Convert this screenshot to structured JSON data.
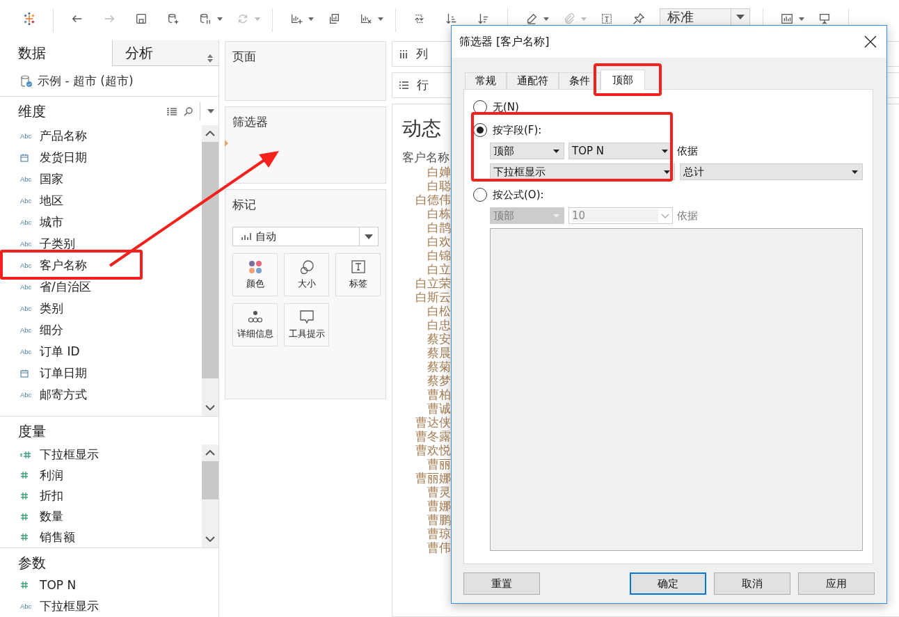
{
  "toolbar": {
    "buttons": [
      {
        "kind": "logo"
      },
      {
        "kind": "sep"
      },
      {
        "kind": "back",
        "disabled": false,
        "menu": false
      },
      {
        "kind": "forward",
        "disabled": true,
        "menu": false
      },
      {
        "kind": "save",
        "disabled": false,
        "menu": false
      },
      {
        "kind": "datasource-add",
        "disabled": false,
        "menu": false
      },
      {
        "kind": "datasource-pause",
        "disabled": false,
        "menu": true
      },
      {
        "kind": "refresh",
        "disabled": true,
        "menu": true
      },
      {
        "kind": "sep"
      },
      {
        "kind": "sheet-add",
        "disabled": false,
        "menu": true
      },
      {
        "kind": "duplicate",
        "disabled": false,
        "menu": false
      },
      {
        "kind": "clear",
        "disabled": false,
        "menu": true
      },
      {
        "kind": "sep"
      },
      {
        "kind": "swap",
        "disabled": false,
        "menu": false
      },
      {
        "kind": "sort-asc",
        "disabled": false,
        "menu": false
      },
      {
        "kind": "sort-desc",
        "disabled": false,
        "menu": false
      },
      {
        "kind": "sep"
      },
      {
        "kind": "pen",
        "disabled": false,
        "menu": true
      },
      {
        "kind": "paperclip",
        "disabled": true,
        "menu": true
      },
      {
        "kind": "label",
        "disabled": false,
        "menu": false
      },
      {
        "kind": "pin",
        "disabled": false,
        "menu": false
      },
      {
        "kind": "view-select",
        "value": "标准"
      },
      {
        "kind": "sep"
      },
      {
        "kind": "show-me",
        "disabled": false,
        "menu": true
      },
      {
        "kind": "presentation",
        "disabled": false,
        "menu": false
      },
      {
        "kind": "sep"
      }
    ]
  },
  "data_pane": {
    "tabs": [
      {
        "label": "数据",
        "selected": true
      },
      {
        "label": "分析",
        "selected": false
      }
    ],
    "datasource": "示例 - 超市 (超市)",
    "sections": [
      {
        "title": "维度",
        "tools": true,
        "fields": [
          {
            "name": "产品名称",
            "kind": "string",
            "type_label": "Abc",
            "marked": false
          },
          {
            "name": "发货日期",
            "kind": "date",
            "marked": false
          },
          {
            "name": "国家",
            "kind": "string",
            "type_label": "Abc",
            "marked": false
          },
          {
            "name": "地区",
            "kind": "string",
            "type_label": "Abc",
            "marked": false
          },
          {
            "name": "城市",
            "kind": "string",
            "type_label": "Abc",
            "marked": false
          },
          {
            "name": "子类别",
            "kind": "string",
            "type_label": "Abc",
            "marked": false
          },
          {
            "name": "客户名称",
            "kind": "string",
            "type_label": "Abc",
            "marked": true
          },
          {
            "name": "省/自治区",
            "kind": "string",
            "type_label": "Abc",
            "marked": false
          },
          {
            "name": "类别",
            "kind": "string",
            "type_label": "Abc",
            "marked": false
          },
          {
            "name": "细分",
            "kind": "string",
            "type_label": "Abc",
            "marked": false
          },
          {
            "name": "订单 ID",
            "kind": "string",
            "type_label": "Abc",
            "marked": false
          },
          {
            "name": "订单日期",
            "kind": "date",
            "marked": false
          },
          {
            "name": "邮寄方式",
            "kind": "string",
            "type_label": "Abc",
            "marked": false
          }
        ]
      },
      {
        "title": "度量",
        "tools": false,
        "fields": [
          {
            "name": "下拉框显示",
            "kind": "calc-number",
            "marked": false
          },
          {
            "name": "利润",
            "kind": "number",
            "marked": false
          },
          {
            "name": "折扣",
            "kind": "number",
            "marked": false
          },
          {
            "name": "数量",
            "kind": "number",
            "marked": false
          },
          {
            "name": "销售额",
            "kind": "number",
            "marked": false
          }
        ]
      },
      {
        "title": "参数",
        "tools": false,
        "fields": [
          {
            "name": "TOP N",
            "kind": "number",
            "marked": false
          },
          {
            "name": "下拉框显示",
            "kind": "string",
            "type_label": "Abc",
            "marked": false
          }
        ]
      }
    ]
  },
  "shelves": {
    "pages": "页面",
    "filters": "筛选器",
    "marks": {
      "title": "标记",
      "mark_type": "自动",
      "buttons": [
        {
          "kind": "color",
          "label": "颜色"
        },
        {
          "kind": "size",
          "label": "大小"
        },
        {
          "kind": "label",
          "label": "标签"
        },
        {
          "kind": "detail",
          "label": "详细信息"
        },
        {
          "kind": "tooltip",
          "label": "工具提示"
        }
      ]
    },
    "columns": "列",
    "rows": "行"
  },
  "viz": {
    "title": "动态",
    "header": "客户名称",
    "names": [
      "白婵",
      "白聪",
      "白德伟",
      "白栋",
      "白鹊",
      "白欢",
      "白锦",
      "白立",
      "白立荣",
      "白斯云",
      "白松",
      "白忠",
      "蔡安",
      "蔡晨",
      "蔡菊",
      "蔡梦",
      "曹柏",
      "曹诚",
      "曹达侠",
      "曹冬露",
      "曹欢悦",
      "曹丽",
      "曹丽娜",
      "曹灵",
      "曹娜",
      "曹鹏",
      "曹琼",
      "曹伟"
    ]
  },
  "annotations": [
    {
      "kind": "arrow"
    }
  ],
  "dialog": {
    "title": "筛选器 [客户名称]",
    "tabs": [
      {
        "label": "常规",
        "selected": false,
        "marked": false
      },
      {
        "label": "通配符",
        "selected": false,
        "marked": false
      },
      {
        "label": "条件",
        "selected": false,
        "marked": false
      },
      {
        "label": "顶部",
        "selected": true,
        "marked": true
      }
    ],
    "options": [
      {
        "label": "无(N)",
        "selected": false,
        "marked": false
      },
      {
        "label": "按字段(F):",
        "selected": true,
        "marked": true,
        "rows": [
          {
            "controls": [
              {
                "kind": "select",
                "value": "顶部",
                "disabled": false
              },
              {
                "kind": "select",
                "value": "TOP N",
                "disabled": false
              },
              {
                "kind": "text",
                "text": "依据",
                "disabled": false
              }
            ]
          },
          {
            "controls": [
              {
                "kind": "select",
                "value": "下拉框显示",
                "disabled": false
              },
              {
                "kind": "select",
                "value": "总计",
                "disabled": false
              }
            ]
          }
        ]
      },
      {
        "label": "按公式(O):",
        "selected": false,
        "marked": false,
        "rows": [
          {
            "controls": [
              {
                "kind": "select",
                "value": "顶部",
                "disabled": true
              },
              {
                "kind": "combo",
                "value": "10",
                "disabled": true
              },
              {
                "kind": "text",
                "text": "依据",
                "disabled": true
              }
            ]
          },
          {
            "controls": [
              {
                "kind": "textarea",
                "disabled": true
              }
            ]
          }
        ]
      }
    ],
    "buttons": [
      {
        "label": "重置",
        "default": false
      },
      {
        "label": "确定",
        "default": true
      },
      {
        "label": "取消",
        "default": false
      },
      {
        "label": "应用",
        "default": false
      }
    ]
  }
}
